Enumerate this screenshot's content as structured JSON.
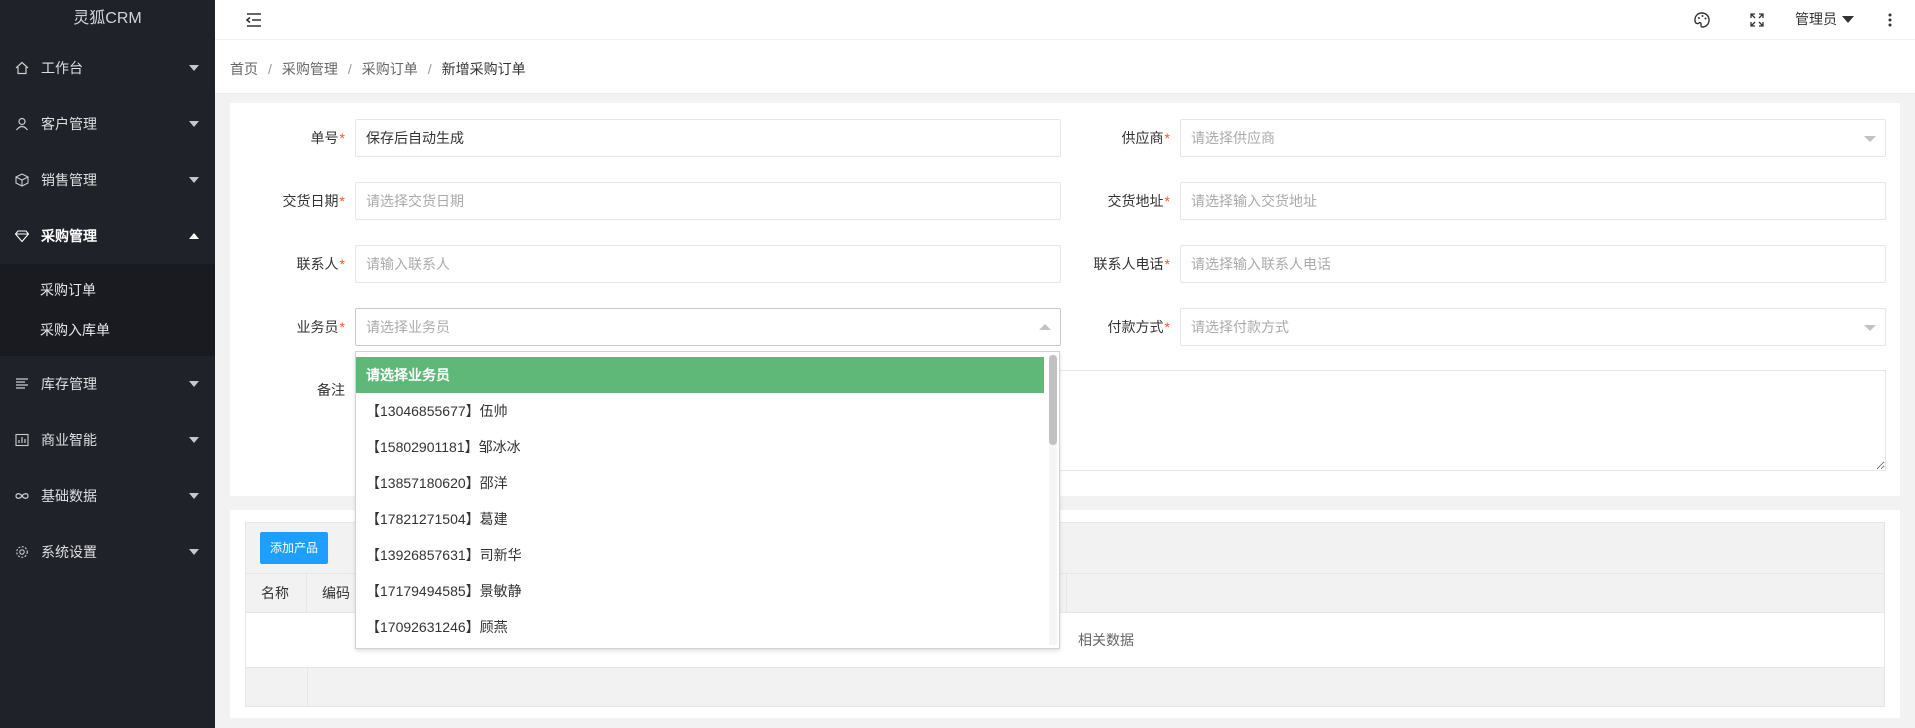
{
  "app": {
    "name": "灵狐CRM"
  },
  "sidebar": {
    "items": [
      {
        "label": "工作台",
        "icon": "home-icon"
      },
      {
        "label": "客户管理",
        "icon": "user-icon"
      },
      {
        "label": "销售管理",
        "icon": "cube-icon"
      },
      {
        "label": "采购管理",
        "icon": "diamond-icon"
      },
      {
        "label": "库存管理",
        "icon": "list-icon"
      },
      {
        "label": "商业智能",
        "icon": "chart-icon"
      },
      {
        "label": "基础数据",
        "icon": "infinity-icon"
      },
      {
        "label": "系统设置",
        "icon": "gear-icon"
      }
    ],
    "subitems": [
      "采购订单",
      "采购入库单"
    ]
  },
  "header": {
    "user": "管理员"
  },
  "breadcrumb": [
    "首页",
    "采购管理",
    "采购订单",
    "新增采购订单"
  ],
  "form": {
    "order_no": {
      "label": "单号",
      "value": "保存后自动生成"
    },
    "supplier": {
      "label": "供应商",
      "placeholder": "请选择供应商"
    },
    "delivery_date": {
      "label": "交货日期",
      "placeholder": "请选择交货日期"
    },
    "delivery_address": {
      "label": "交货地址",
      "placeholder": "请选择输入交货地址"
    },
    "contact": {
      "label": "联系人",
      "placeholder": "请输入联系人"
    },
    "contact_phone": {
      "label": "联系人电话",
      "placeholder": "请选择输入联系人电话"
    },
    "salesman": {
      "label": "业务员",
      "placeholder": "请选择业务员"
    },
    "payment": {
      "label": "付款方式",
      "placeholder": "请选择付款方式"
    },
    "remark": {
      "label": "备注"
    },
    "required_mark": "*"
  },
  "table": {
    "add_button": "添加产品",
    "columns": [
      "名称",
      "编码"
    ],
    "empty_partial": "相关数据"
  },
  "dropdown": {
    "options": [
      "请选择业务员",
      "【13046855677】伍帅",
      "【15802901181】邹冰冰",
      "【13857180620】邵洋",
      "【17821271504】葛建",
      "【13926857631】司新华",
      "【17179494585】景敏静",
      "【17092631246】顾燕"
    ]
  },
  "colors": {
    "sidebar_bg": "#20222a",
    "selected_option": "#5fb878",
    "primary_button": "#1e9fff",
    "required": "#ff5722"
  }
}
